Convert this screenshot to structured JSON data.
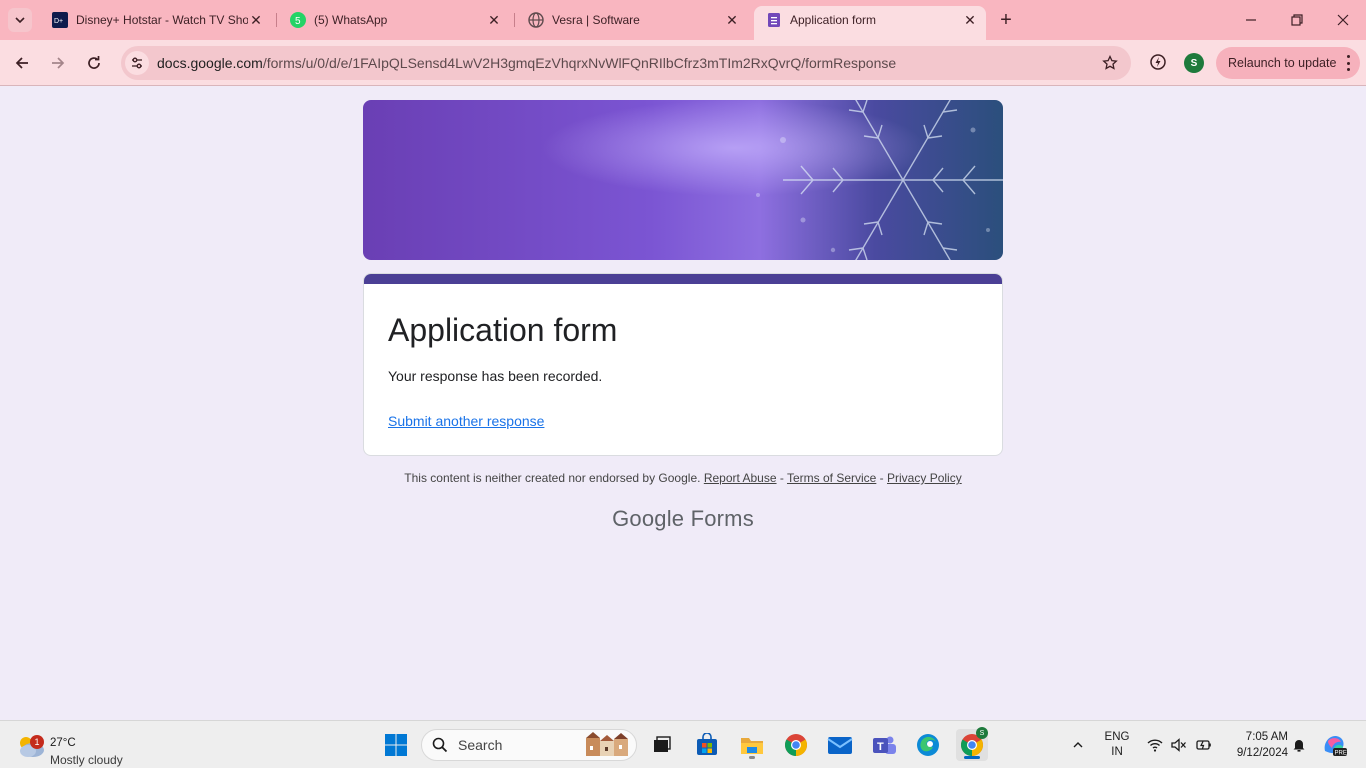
{
  "tabs": [
    {
      "title": "Disney+ Hotstar - Watch TV Shows",
      "icon": "hotstar-icon"
    },
    {
      "title": "(5) WhatsApp",
      "icon": "whatsapp-icon",
      "badge": "5"
    },
    {
      "title": "Vesra | Software",
      "icon": "globe-icon"
    },
    {
      "title": "Application form",
      "icon": "google-forms-icon",
      "active": true
    }
  ],
  "toolbar": {
    "url_host": "docs.google.com",
    "url_path": "/forms/u/0/d/e/1FAIpQLSensd4LwV2H3gmqEzVhqrxNvWlFQnRIlbCfrz3mTIm2RxQvrQ/formResponse",
    "profile_initial": "S",
    "relaunch_label": "Relaunch to update"
  },
  "form": {
    "title": "Application form",
    "message": "Your response has been recorded.",
    "submit_another": "Submit another response"
  },
  "footer": {
    "note": "This content is neither created nor endorsed by Google.",
    "report_abuse": "Report Abuse",
    "sep1": " - ",
    "terms": "Terms of Service",
    "sep2": " - ",
    "privacy": "Privacy Policy",
    "brand_google": "Google",
    "brand_forms": "Forms"
  },
  "taskbar": {
    "weather_badge": "1",
    "temperature": "27°C",
    "weather_desc": "Mostly cloudy",
    "search_label": "Search",
    "chrome_badge": "S",
    "lang_line1": "ENG",
    "lang_line2": "IN",
    "time": "7:05 AM",
    "date": "9/12/2024"
  },
  "colors": {
    "tabstrip": "#f9b6c0",
    "toolbar": "#fbdde1",
    "page_bg": "#f0ebf8",
    "form_accent": "#4b3f95",
    "link": "#1a73e8"
  }
}
